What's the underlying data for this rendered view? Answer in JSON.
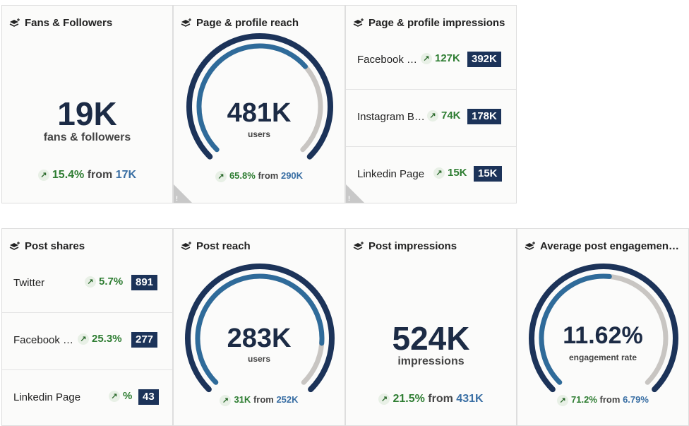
{
  "colors": {
    "navy": "#1c3359",
    "blue": "#2f6b9a",
    "gray_track": "#c8c5c2",
    "green": "#2e7d32",
    "prev_blue": "#3a6fa4"
  },
  "icons": {
    "card_icon": "layers-icon",
    "trend": "arrow-up-right-icon",
    "warning": "warning-icon"
  },
  "cards": {
    "fans": {
      "title": "Fans & Followers",
      "value": "19K",
      "subtitle": "fans & followers",
      "delta_pct": "15.4%",
      "from_word": "from",
      "prev": "17K"
    },
    "page_reach": {
      "title": "Page & profile reach",
      "value": "481K",
      "subtitle": "users",
      "delta_pct": "65.8%",
      "from_word": "from",
      "prev": "290K",
      "gauge_fraction": 0.68
    },
    "page_impressions": {
      "title": "Page & profile impressions",
      "rows": [
        {
          "label": "Facebook …",
          "delta": "127K",
          "value": "392K"
        },
        {
          "label": "Instagram B…",
          "delta": "74K",
          "value": "178K"
        },
        {
          "label": "Linkedin Page",
          "delta": "15K",
          "value": "15K"
        }
      ]
    },
    "post_shares": {
      "title": "Post shares",
      "rows": [
        {
          "label": "Twitter",
          "delta": "5.7%",
          "value": "891"
        },
        {
          "label": "Facebook …",
          "delta": "25.3%",
          "value": "277"
        },
        {
          "label": "Linkedin Page",
          "delta": "%",
          "value": "43"
        }
      ]
    },
    "post_reach": {
      "title": "Post reach",
      "value": "283K",
      "subtitle": "users",
      "delta_pct": "31K",
      "from_word": "from",
      "prev": "252K",
      "gauge_fraction": 0.85
    },
    "post_impressions": {
      "title": "Post impressions",
      "value": "524K",
      "subtitle": "impressions",
      "delta_pct": "21.5%",
      "from_word": "from",
      "prev": "431K"
    },
    "engagement": {
      "title": "Average post engagemen…",
      "value": "11.62%",
      "subtitle": "engagement rate",
      "delta_pct": "71.2%",
      "from_word": "from",
      "prev": "6.79%",
      "gauge_fraction": 0.52
    }
  }
}
